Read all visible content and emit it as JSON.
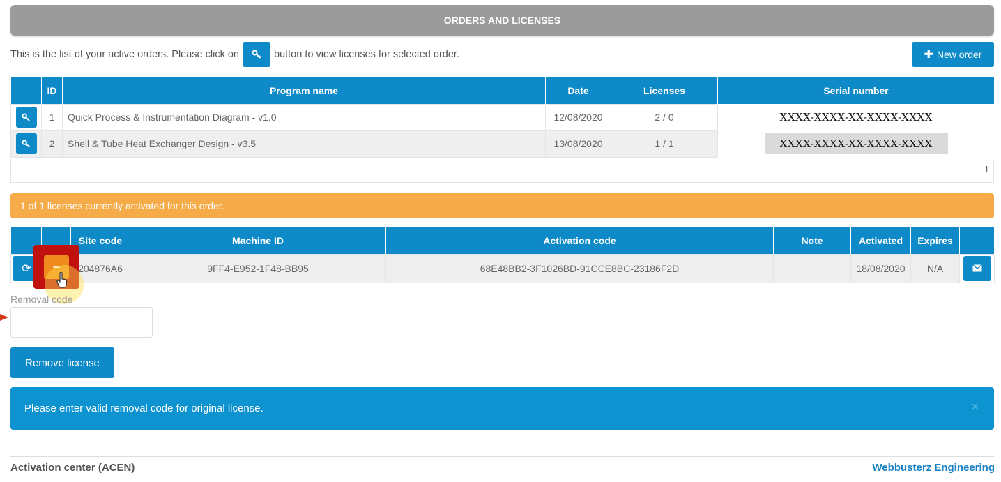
{
  "header": {
    "title": "ORDERS AND LICENSES"
  },
  "intro": {
    "before": "This is the list of your active orders. Please click on",
    "after": "button to view licenses for selected order."
  },
  "new_order_label": "New order",
  "orders": {
    "columns": [
      "",
      "ID",
      "Program name",
      "Date",
      "Licenses",
      "Serial number"
    ],
    "rows": [
      {
        "id": "1",
        "program": "Quick Process & Instrumentation Diagram - v1.0",
        "date": "12/08/2020",
        "licenses": "2 / 0",
        "serial": "XXXX-XXXX-XX-XXXX-XXXX"
      },
      {
        "id": "2",
        "program": "Shell & Tube Heat Exchanger Design - v3.5",
        "date": "13/08/2020",
        "licenses": "1 / 1",
        "serial": "XXXX-XXXX-XX-XXXX-XXXX"
      }
    ],
    "page": "1"
  },
  "license_status": "1 of 1 licenses currently activated for this order.",
  "licenses": {
    "columns": [
      "",
      "",
      "Site code",
      "Machine ID",
      "Activation code",
      "Note",
      "Activated",
      "Expires",
      ""
    ],
    "row": {
      "site_code": "204876A6",
      "machine_id": "9FF4-E952-1F48-BB95",
      "activation_code": "68E48BB2-3F1026BD-91CCE8BC-23186F2D",
      "note": "",
      "activated": "18/08/2020",
      "expires": "N/A"
    }
  },
  "removal": {
    "label": "Removal code",
    "value": "",
    "placeholder": ""
  },
  "remove_button_label": "Remove license",
  "alert": {
    "message": "Please enter valid removal code for original license.",
    "close": "×"
  },
  "footer": {
    "left": "Activation center (ACEN)",
    "right": "Webbusterz Engineering"
  },
  "colors": {
    "primary": "#0e8ac8",
    "warning": "#f5ab48",
    "header": "#9b9b9b",
    "highlight": "#c0110f"
  }
}
